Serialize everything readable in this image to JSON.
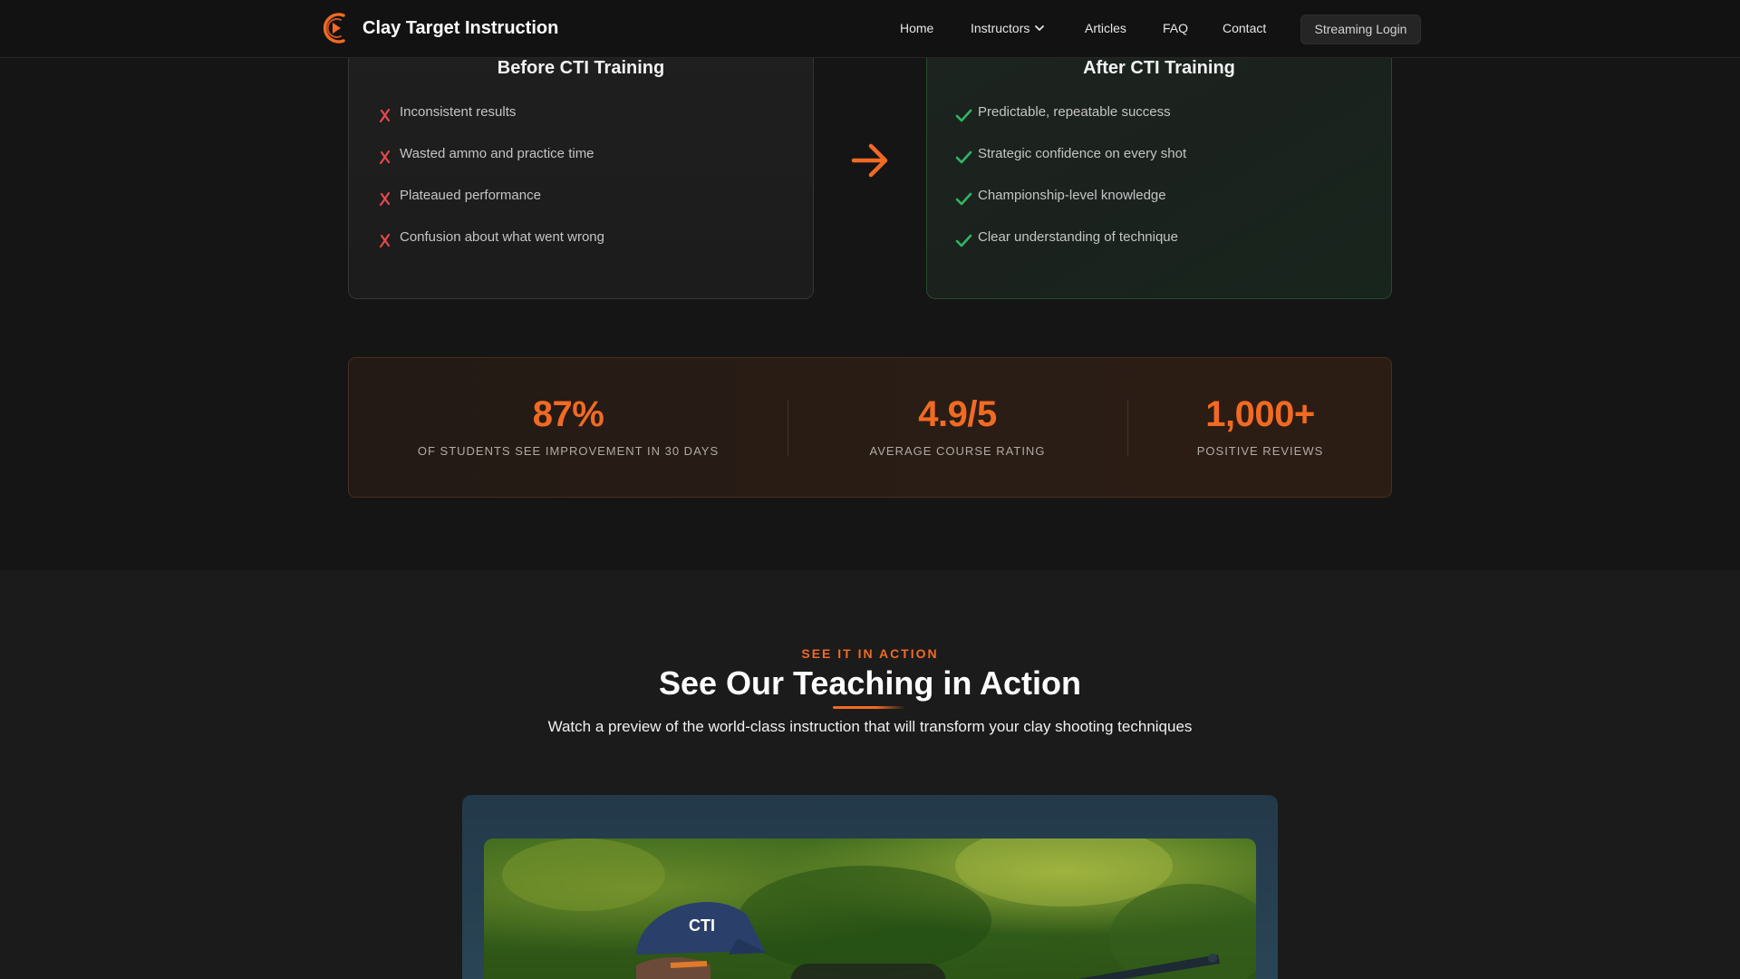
{
  "header": {
    "brand": "Clay Target Instruction",
    "nav": {
      "home": "Home",
      "instructors": "Instructors",
      "articles": "Articles",
      "faq": "FAQ",
      "contact": "Contact"
    },
    "login_label": "Streaming Login"
  },
  "comparison": {
    "before": {
      "title": "Before CTI Training",
      "items": [
        "Inconsistent results",
        "Wasted ammo and practice time",
        "Plateaued performance",
        "Confusion about what went wrong"
      ]
    },
    "after": {
      "title": "After CTI Training",
      "items": [
        "Predictable, repeatable success",
        "Strategic confidence on every shot",
        "Championship-level knowledge",
        "Clear understanding of technique"
      ]
    }
  },
  "stats": [
    {
      "value": "87%",
      "label": "OF STUDENTS SEE IMPROVEMENT IN 30 DAYS"
    },
    {
      "value": "4.9/5",
      "label": "AVERAGE COURSE RATING"
    },
    {
      "value": "1,000+",
      "label": "POSITIVE REVIEWS"
    }
  ],
  "action_section": {
    "eyebrow": "SEE IT IN ACTION",
    "title": "See Our Teaching in Action",
    "subtitle": "Watch a preview of the world-class instruction that will transform your clay shooting techniques"
  },
  "colors": {
    "accent": "#f26a22",
    "success": "#2fb765",
    "error": "#e5484d",
    "background": "#151515"
  },
  "icons": {
    "logo": "clay-target-logo-icon",
    "before_mark": "x-mark-icon",
    "after_mark": "check-icon",
    "transition": "arrow-right-icon",
    "dropdown": "chevron-down-icon"
  }
}
